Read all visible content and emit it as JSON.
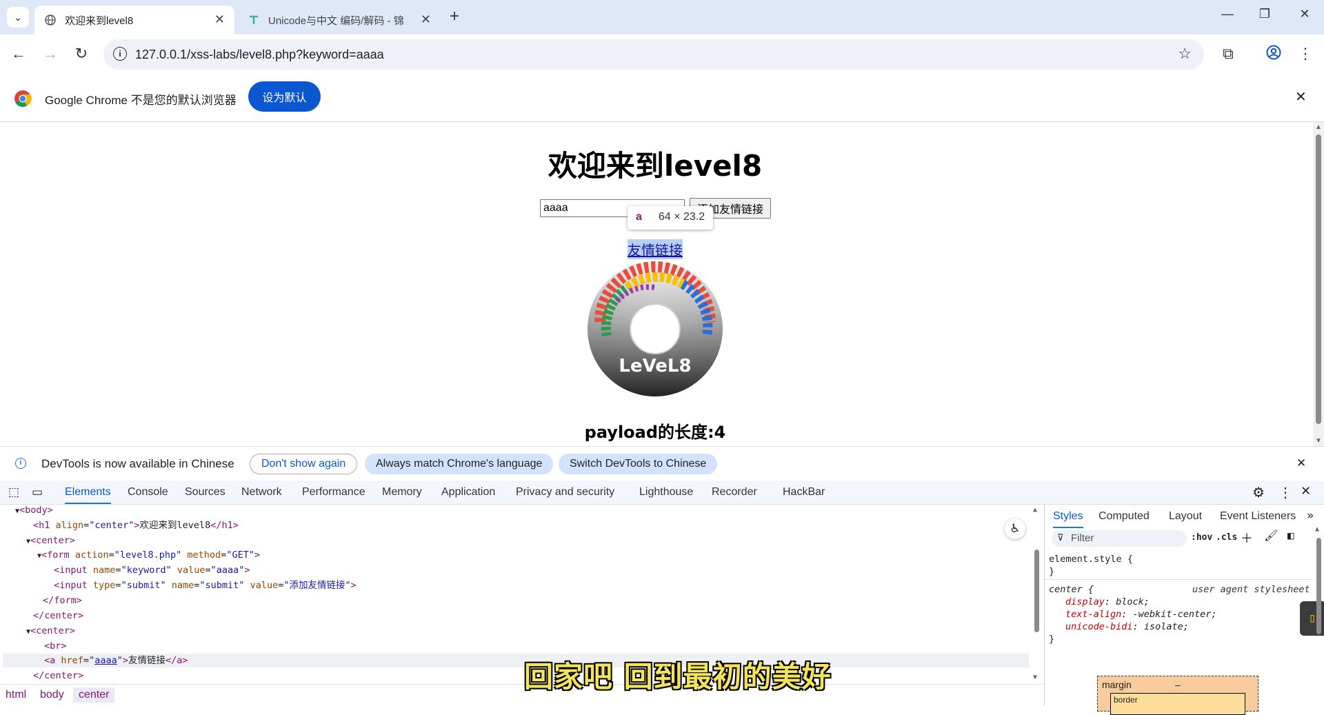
{
  "tabs": [
    {
      "title": "欢迎来到level8",
      "active": true
    },
    {
      "title": "Unicode与中文 编码/解码 - 锦",
      "active": false
    }
  ],
  "toolbar": {
    "url": "127.0.0.1/xss-labs/level8.php?keyword=aaaa"
  },
  "infobar": {
    "message": "Google Chrome 不是您的默认浏览器",
    "set_default": "设为默认"
  },
  "page": {
    "heading": "欢迎来到level8",
    "keyword_value": "aaaa",
    "submit_label": "添加友情链接",
    "link_text": "友情链接",
    "tooltip_tag": "a",
    "tooltip_size": "64 × 23.2",
    "image_text": "LeVeL8",
    "payload_text": "payload的长度:4"
  },
  "devtools_banner": {
    "message": "DevTools is now available in Chinese",
    "dont_show": "Don't show again",
    "match_language": "Always match Chrome's language",
    "switch": "Switch DevTools to Chinese"
  },
  "devtools_tabs": [
    "Elements",
    "Console",
    "Sources",
    "Network",
    "Performance",
    "Memory",
    "Application",
    "Privacy and security",
    "Lighthouse",
    "Recorder",
    "HackBar"
  ],
  "elements": {
    "body_open": "<body>",
    "h1_tag_open": "<h1 ",
    "h1_attr": "align",
    "h1_val": "\"center\"",
    "h1_text": "欢迎来到level8",
    "h1_close": "</h1>",
    "center_open": "<center>",
    "form_attr1": "action",
    "form_val1": "\"level8.php\"",
    "form_attr2": "method",
    "form_val2": "\"GET\"",
    "input1_attr1": "name",
    "input1_val1": "\"keyword\"",
    "input1_attr2": "value",
    "input1_val2": "\"aaaa\"",
    "input2_attr1": "type",
    "input2_val1": "\"submit\"",
    "input2_attr2": "name",
    "input2_val2": "\"submit\"",
    "input2_attr3": "value",
    "input2_val3": "\"添加友情链接\"",
    "form_close": "</form>",
    "center_close": "</center>",
    "br": "<br>",
    "a_attr": "href",
    "a_val": "aaaa",
    "a_text": "友情链接",
    "a_close": "</a>"
  },
  "breadcrumb": [
    "html",
    "body",
    "center"
  ],
  "styles": {
    "tabs": [
      "Styles",
      "Computed",
      "Layout",
      "Event Listeners"
    ],
    "filter_placeholder": "Filter",
    "hov": ":hov",
    "cls": ".cls",
    "element_style": "element.style {",
    "close_brace": "}",
    "center_selector": "center {",
    "source": "user agent stylesheet",
    "props": [
      {
        "name": "display",
        "value": "block;"
      },
      {
        "name": "text-align",
        "value": "-webkit-center;"
      },
      {
        "name": "unicode-bidi",
        "value": "isolate;"
      }
    ],
    "box_margin": "margin",
    "box_margin_value": "–",
    "box_border": "border"
  },
  "caption": "回家吧 回到最初的美好",
  "colors": {
    "accent": "#0b57d0",
    "devtools_active": "#1a73e8",
    "tag": "#881280",
    "attr": "#994500",
    "value": "#1a1aa6"
  }
}
